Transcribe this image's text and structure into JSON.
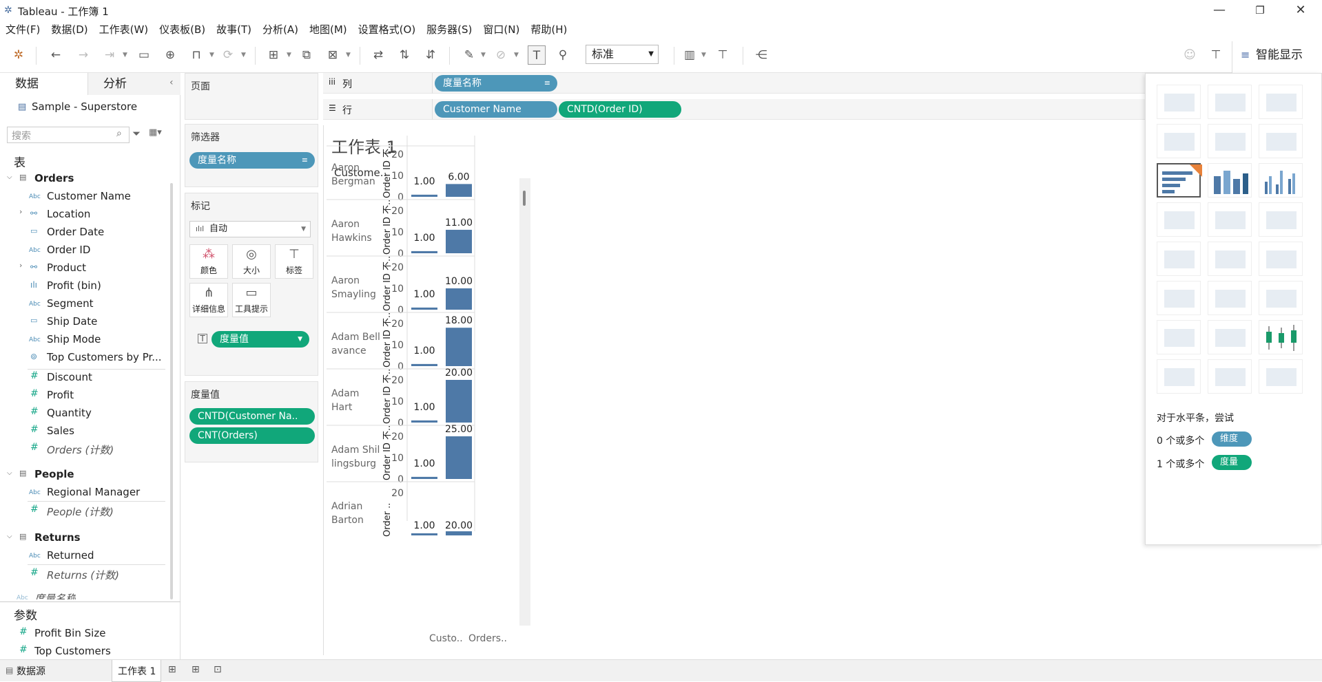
{
  "window": {
    "title": "Tableau - 工作簿 1",
    "minimize": "—",
    "restore": "❐",
    "close": "✕"
  },
  "menu": [
    "文件(F)",
    "数据(D)",
    "工作表(W)",
    "仪表板(B)",
    "故事(T)",
    "分析(A)",
    "地图(M)",
    "设置格式(O)",
    "服务器(S)",
    "窗口(N)",
    "帮助(H)"
  ],
  "toolbar": {
    "fit_value": "标准",
    "show_me_label": "智能显示"
  },
  "datapane": {
    "tab_data": "数据",
    "tab_analysis": "分析",
    "datasource": "Sample - Superstore",
    "search_placeholder": "搜索",
    "section_tables": "表",
    "tables": [
      {
        "name": "Orders",
        "fields": [
          {
            "name": "Customer Name",
            "type": "Abc"
          },
          {
            "name": "Location",
            "type": "hier"
          },
          {
            "name": "Order Date",
            "type": "date"
          },
          {
            "name": "Order ID",
            "type": "Abc"
          },
          {
            "name": "Product",
            "type": "hier"
          },
          {
            "name": "Profit (bin)",
            "type": "bin"
          },
          {
            "name": "Segment",
            "type": "Abc"
          },
          {
            "name": "Ship Date",
            "type": "date"
          },
          {
            "name": "Ship Mode",
            "type": "Abc"
          },
          {
            "name": "Top Customers by Pr...",
            "type": "set"
          },
          {
            "name": "Discount",
            "type": "#"
          },
          {
            "name": "Profit",
            "type": "#"
          },
          {
            "name": "Quantity",
            "type": "#"
          },
          {
            "name": "Sales",
            "type": "#"
          },
          {
            "name": "Orders (计数)",
            "type": "#"
          }
        ]
      },
      {
        "name": "People",
        "fields": [
          {
            "name": "Regional Manager",
            "type": "Abc"
          },
          {
            "name": "People (计数)",
            "type": "#"
          }
        ]
      },
      {
        "name": "Returns",
        "fields": [
          {
            "name": "Returned",
            "type": "Abc"
          },
          {
            "name": "Returns (计数)",
            "type": "#"
          }
        ]
      }
    ],
    "measure_names": "度量名称",
    "section_params": "参数",
    "params": [
      "Profit Bin Size",
      "Top Customers"
    ]
  },
  "shelves": {
    "pages": "页面",
    "filters": "筛选器",
    "filter_pill": "度量名称",
    "marks": "标记",
    "mark_type": "自动",
    "mark_buttons": [
      "颜色",
      "大小",
      "标签",
      "详细信息",
      "工具提示"
    ],
    "marks_pill": "度量值",
    "measure_values_title": "度量值",
    "measure_values_pills": [
      "CNTD(Customer Na..",
      "CNT(Orders)"
    ],
    "columns_label": "列",
    "rows_label": "行",
    "columns_pills": [
      "度量名称"
    ],
    "rows_pills": [
      "Customer Name",
      "CNTD(Order ID)"
    ]
  },
  "sheet_title": "工作表 1",
  "view": {
    "row_header": "Custome..",
    "axis_title": "Order ID 不..",
    "axis_title_short": "Order ..",
    "col_footers": [
      "Custo..",
      "Orders.."
    ]
  },
  "chart_data": {
    "type": "bar",
    "categories": [
      "Aaron Bergman",
      "Aaron Hawkins",
      "Aaron Smayling",
      "Adam Bellavance",
      "Adam Hart",
      "Adam Shillingsburg",
      "Adrian Barton"
    ],
    "category_display": [
      [
        "Aaron",
        "Bergman"
      ],
      [
        "Aaron",
        "Hawkins"
      ],
      [
        "Aaron",
        "Smayling"
      ],
      [
        "Adam Bell",
        "avance"
      ],
      [
        "Adam",
        "Hart"
      ],
      [
        "Adam Shil",
        "lingsburg"
      ],
      [
        "Adrian",
        "Barton"
      ]
    ],
    "series": [
      {
        "name": "CNTD(Customer Na..",
        "values": [
          1,
          1,
          1,
          1,
          1,
          1,
          1
        ],
        "labels": [
          "1.00",
          "1.00",
          "1.00",
          "1.00",
          "1.00",
          "1.00",
          "1.00"
        ]
      },
      {
        "name": "CNT(Orders)",
        "values": [
          6,
          11,
          10,
          18,
          20,
          25,
          20
        ],
        "labels": [
          "6.00",
          "11.00",
          "10.00",
          "18.00",
          "20.00",
          "25.00",
          "20.00"
        ]
      }
    ],
    "ylim": [
      0,
      20
    ],
    "yticks": [
      "20",
      "10",
      "0"
    ],
    "bar_color": "#4e79a7"
  },
  "showme": {
    "hint": "对于水平条，尝试",
    "req1_prefix": "0 个或多个",
    "req1_pill": "维度",
    "req2_prefix": "1 个或多个",
    "req2_pill": "度量"
  },
  "bottom": {
    "datasource_tab": "数据源",
    "sheet_tab": "工作表 1"
  },
  "colors": {
    "dimension_pill": "#4d97b9",
    "measure_pill": "#11a77a",
    "bar": "#4e79a7"
  }
}
